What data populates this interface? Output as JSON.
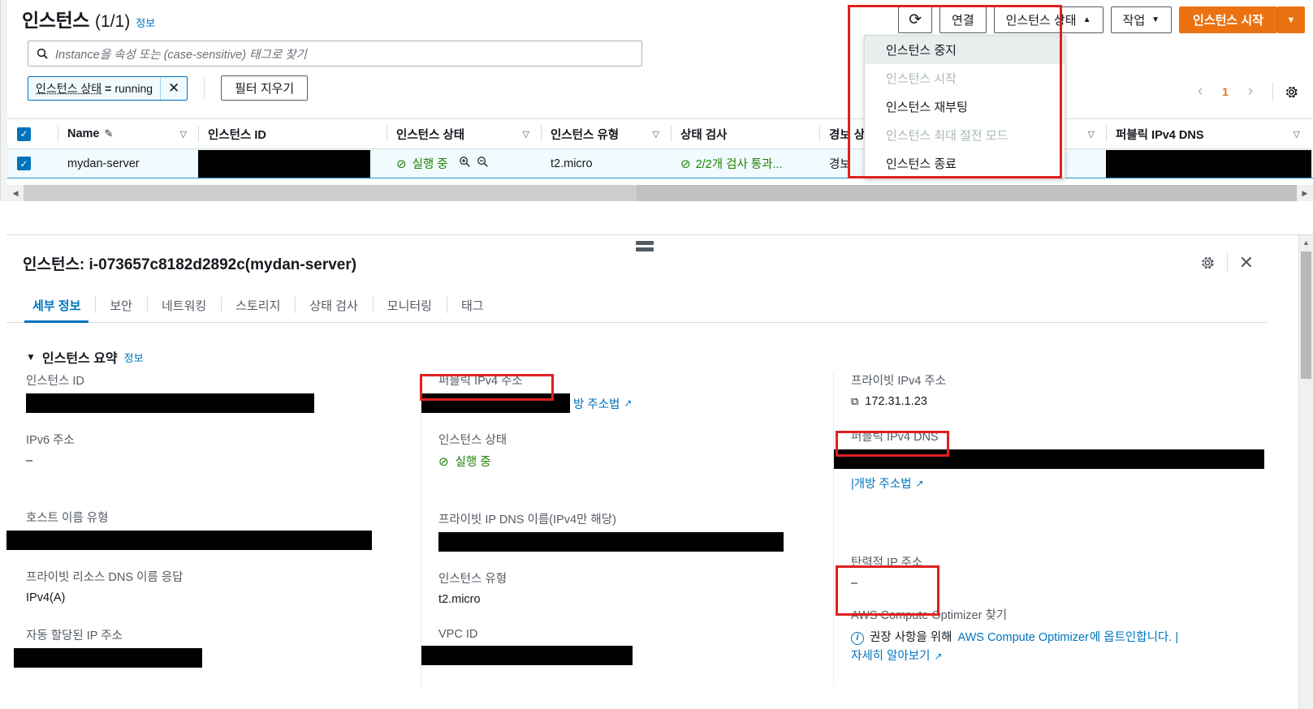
{
  "header": {
    "title": "인스턴스",
    "count": "(1/1)",
    "info_link": "정보"
  },
  "toolbar": {
    "refresh_icon": "refresh-icon",
    "connect_label": "연결",
    "instance_state_label": "인스턴스 상태",
    "instance_state_caret": "▲",
    "actions_label": "작업",
    "actions_caret": "▼",
    "launch_label": "인스턴스 시작",
    "launch_caret": "▼"
  },
  "dropdown": {
    "items": [
      {
        "label": "인스턴스 중지",
        "state": "hover"
      },
      {
        "label": "인스턴스 시작",
        "state": "disabled"
      },
      {
        "label": "인스턴스 재부팅",
        "state": "normal"
      },
      {
        "label": "인스턴스 최대 절전 모드",
        "state": "disabled"
      },
      {
        "label": "인스턴스 종료",
        "state": "normal"
      }
    ]
  },
  "search": {
    "placeholder": "Instance을 속성 또는 (case-sensitive) 태그로 찾기",
    "icon": "search-icon"
  },
  "filters": {
    "token_key": "인스턴스 상태",
    "token_op": "=",
    "token_value": "running",
    "token_remove": "✕",
    "clear_label": "필터 지우기"
  },
  "pagination": {
    "prev": "‹",
    "page": "1",
    "next": "›",
    "settings_icon": "gear-icon"
  },
  "table": {
    "columns": [
      {
        "label": "Name",
        "sortable": true,
        "editable": true
      },
      {
        "label": "인스턴스 ID",
        "sortable": false
      },
      {
        "label": "인스턴스 상태",
        "sortable": true
      },
      {
        "label": "인스턴스 유형",
        "sortable": true
      },
      {
        "label": "상태 검사",
        "sortable": false
      },
      {
        "label": "경보 상태",
        "sortable": true
      },
      {
        "label": "퍼블릭 IPv4 DNS",
        "sortable": true
      }
    ],
    "rows": [
      {
        "selected": true,
        "name": "mydan-server",
        "instance_id": "",
        "state_icon": "check-circle-icon",
        "state": "실행 중",
        "zoom_in_icon": "zoom-in-icon",
        "zoom_out_icon": "zoom-out-icon",
        "type": "t2.micro",
        "status_check_icon": "check-circle-icon",
        "status_check": "2/2개 검사 통과...",
        "alarm": "경보",
        "public_dns": ""
      }
    ]
  },
  "detail": {
    "resize_handle": "panel-resize-handle",
    "title": "인스턴스: i-073657c8182d2892c(mydan-server)",
    "settings_icon": "gear-icon",
    "close_icon": "close-icon",
    "tabs": [
      {
        "label": "세부 정보",
        "active": true
      },
      {
        "label": "보안",
        "active": false
      },
      {
        "label": "네트워킹",
        "active": false
      },
      {
        "label": "스토리지",
        "active": false
      },
      {
        "label": "상태 검사",
        "active": false
      },
      {
        "label": "모니터링",
        "active": false
      },
      {
        "label": "태그",
        "active": false
      }
    ],
    "summary": {
      "caret": "▼",
      "title": "인스턴스 요약",
      "info_link": "정보"
    },
    "left_column": [
      {
        "label": "인스턴스 ID",
        "value": "",
        "redacted": true,
        "redact_width": 355
      },
      {
        "label": "IPv6 주소",
        "value": "–",
        "redacted": false
      },
      {
        "label": "호스트 이름 유형",
        "value": "",
        "redacted": true,
        "redact_width": 450
      },
      {
        "label": "프라이빗 리소스 DNS 이름 응답",
        "value": "IPv4(A)",
        "redacted": false
      },
      {
        "label": "자동 할당된 IP 주소",
        "value": "",
        "redacted": true,
        "redact_width": 232
      }
    ],
    "mid_column": [
      {
        "label": "퍼블릭 IPv4 주소",
        "value": "",
        "redacted": true,
        "redact_width": 183,
        "link": "방 주소법",
        "link_icon": "external-link-icon",
        "highlight": true
      },
      {
        "label": "인스턴스 상태",
        "value": "실행 중",
        "status_icon": "check-circle-icon",
        "redacted": false
      },
      {
        "label": "프라이빗 IP DNS 이름(IPv4만 해당)",
        "value": "",
        "redacted": true,
        "redact_width": 425
      },
      {
        "label": "인스턴스 유형",
        "value": "t2.micro",
        "redacted": false
      },
      {
        "label": "VPC ID",
        "value": "",
        "redacted": true,
        "redact_width": 260
      }
    ],
    "right_column": [
      {
        "label": "프라이빗 IPv4 주소",
        "value": "172.31.1.23",
        "copy_icon": "copy-icon",
        "redacted": false
      },
      {
        "label": "퍼블릭 IPv4 DNS",
        "value": "",
        "redacted": true,
        "redact_width": 530,
        "link": "|개방 주소법",
        "link_icon": "external-link-icon",
        "highlight": true
      },
      {
        "label": "탄력적 IP 주소",
        "value": "–",
        "redacted": false,
        "highlight": true
      }
    ],
    "optimizer": {
      "title": "AWS Compute Optimizer 찾기",
      "info_icon": "info-icon",
      "message_prefix": "권장 사항을 위해",
      "message_link": "AWS Compute Optimizer",
      "message_suffix": "에 옵트인합니다. |",
      "learn_more": "자세히 알아보기",
      "learn_more_icon": "external-link-icon"
    }
  },
  "colors": {
    "accent_orange": "#ec7211",
    "link_blue": "#0073bb",
    "success_green": "#1d8102",
    "annotation_red": "#e02020",
    "row_selected": "#f1faff"
  }
}
